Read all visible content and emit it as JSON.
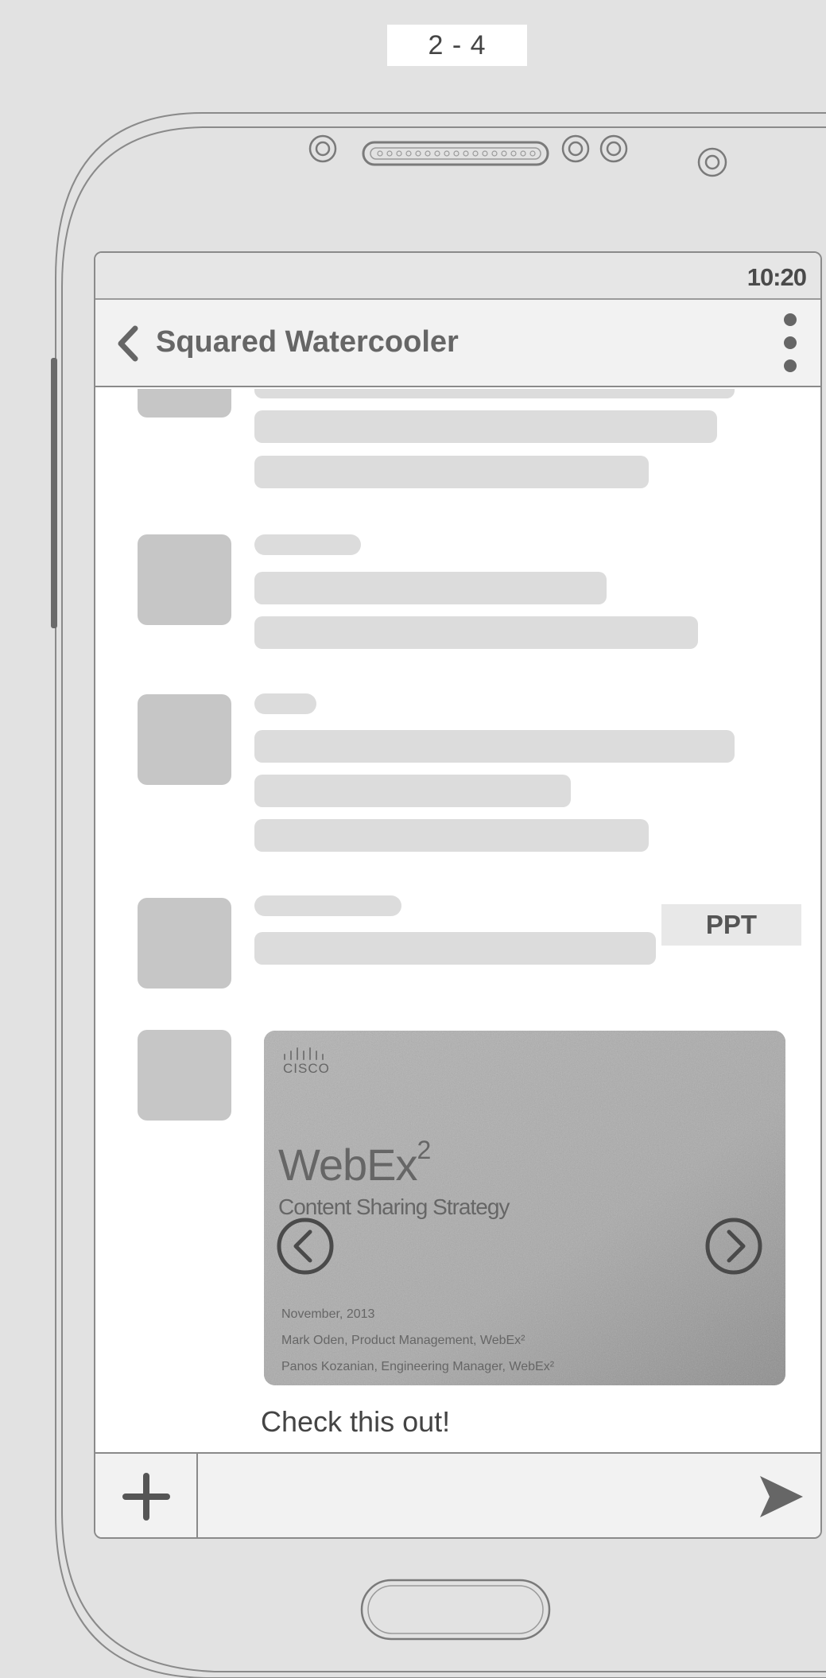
{
  "page_label": "2 - 4",
  "status_bar": {
    "time": "10:20"
  },
  "app_bar": {
    "title": "Squared Watercooler"
  },
  "attachment": {
    "type_badge": "PPT",
    "logo_text": "CISCO",
    "slide_title": "WebEx",
    "slide_title_sup": "2",
    "slide_subtitle": "Content Sharing Strategy",
    "slide_date": "November, 2013",
    "slide_author_1": "Mark Oden, Product Management, WebEx²",
    "slide_author_2": "Panos Kozanian, Engineering Manager, WebEx²",
    "prev_icon": "chevron-left-circle-icon",
    "next_icon": "chevron-right-circle-icon"
  },
  "message": {
    "text": "Check this out!"
  },
  "composer": {
    "input_value": "",
    "add_icon": "plus-icon",
    "send_icon": "send-icon"
  },
  "colors": {
    "background": "#e2e2e2",
    "placeholder_bar": "#dcdcdc",
    "avatar": "#c6c6c6",
    "title_text": "#666666"
  }
}
